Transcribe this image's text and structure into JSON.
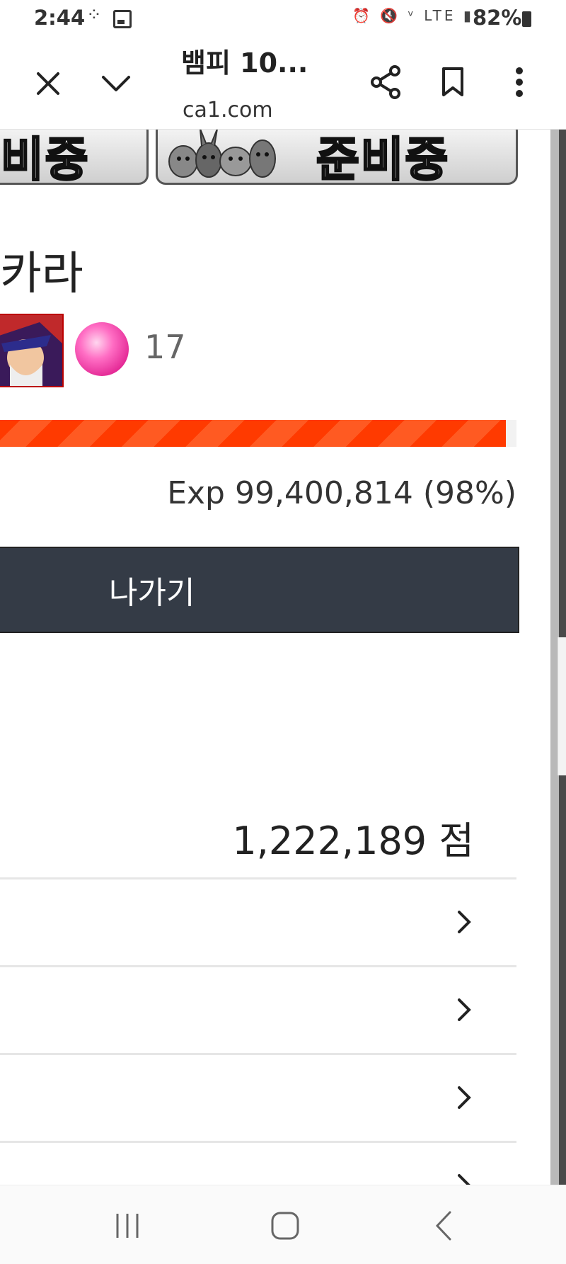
{
  "status_bar": {
    "time": "2:44",
    "battery": "82%",
    "network": "LTE"
  },
  "browser": {
    "title": "뱀피 10...",
    "url": "ca1.com"
  },
  "banners": [
    {
      "text": "비중"
    },
    {
      "text": "준비중"
    }
  ],
  "character": {
    "title": "카라",
    "level": "17",
    "exp_text": "Exp 99,400,814 (98%)",
    "exp_percent": 98
  },
  "exit_button": {
    "label": "나가기"
  },
  "score": {
    "text": "1,222,189 점"
  },
  "menu_rows": [
    {
      "chevron": "chevron-right-icon"
    },
    {
      "chevron": "chevron-right-icon"
    },
    {
      "chevron": "chevron-right-icon"
    },
    {
      "chevron": "chevron-right-icon"
    }
  ],
  "colors": {
    "exp_bar": "#ff3a00",
    "exit_button_bg": "#343b46",
    "orb": "#ff6ec4"
  }
}
